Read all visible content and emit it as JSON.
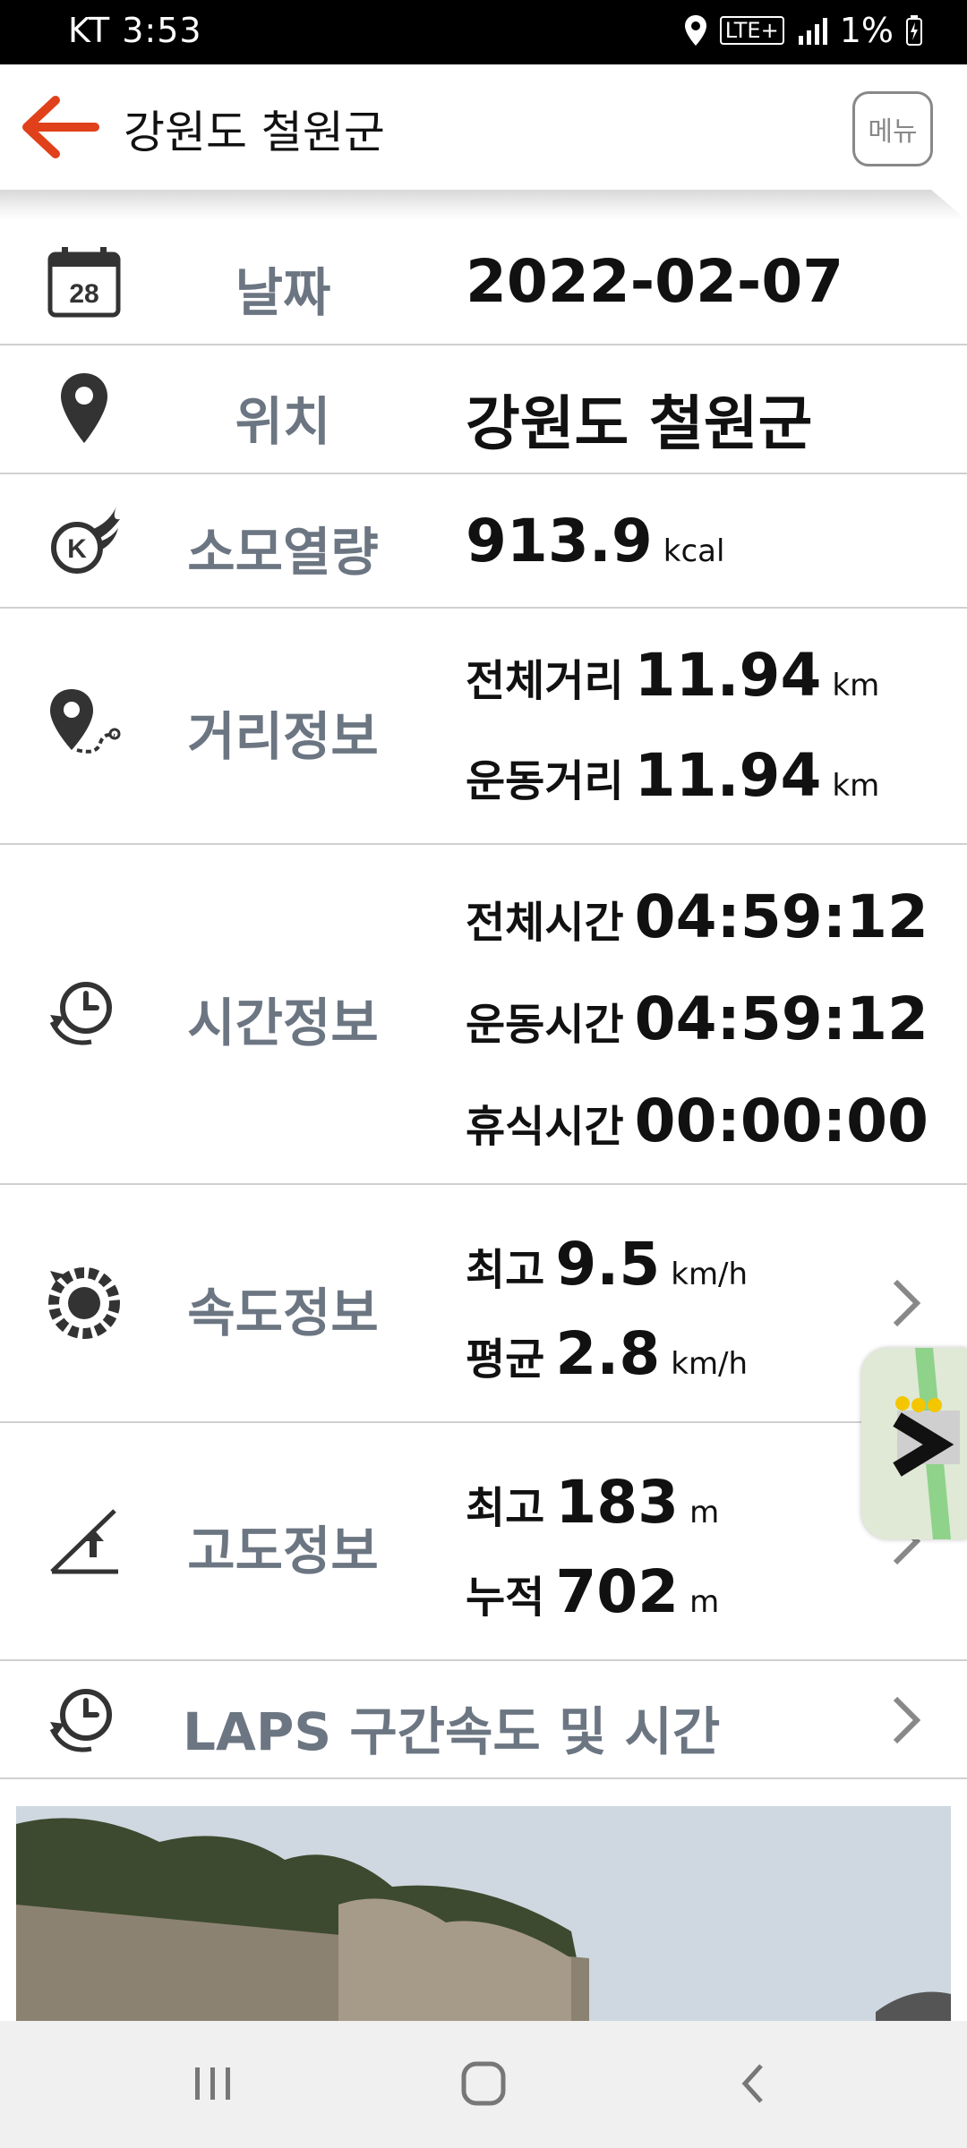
{
  "status_bar": {
    "carrier_time": "KT 3:53",
    "network": "LTE+",
    "battery": "1%"
  },
  "header": {
    "title": "강원도 철원군",
    "menu_label": "메뉴"
  },
  "rows": {
    "date": {
      "label": "날짜",
      "value": "2022-02-07",
      "icon_day": "28"
    },
    "location": {
      "label": "위치",
      "value": "강원도 철원군"
    },
    "calories": {
      "label": "소모열량",
      "value": "913.9",
      "unit": "kcal"
    },
    "distance": {
      "label": "거리정보",
      "total_label": "전체거리",
      "total_value": "11.94",
      "total_unit": "km",
      "moving_label": "운동거리",
      "moving_value": "11.94",
      "moving_unit": "km"
    },
    "time": {
      "label": "시간정보",
      "total_label": "전체시간",
      "total_value": "04:59:12",
      "moving_label": "운동시간",
      "moving_value": "04:59:12",
      "rest_label": "휴식시간",
      "rest_value": "00:00:00"
    },
    "speed": {
      "label": "속도정보",
      "max_label": "최고",
      "max_value": "9.5",
      "max_unit": "km/h",
      "avg_label": "평균",
      "avg_value": "2.8",
      "avg_unit": "km/h"
    },
    "altitude": {
      "label": "고도정보",
      "max_label": "최고",
      "max_value": "183",
      "max_unit": "m",
      "cum_label": "누적",
      "cum_value": "702",
      "cum_unit": "m"
    },
    "laps": {
      "label": "LAPS 구간속도 및 시간"
    }
  },
  "colors": {
    "accent": "#e0411a",
    "label_gray": "#6c7682",
    "divider": "#d0d0d0"
  }
}
